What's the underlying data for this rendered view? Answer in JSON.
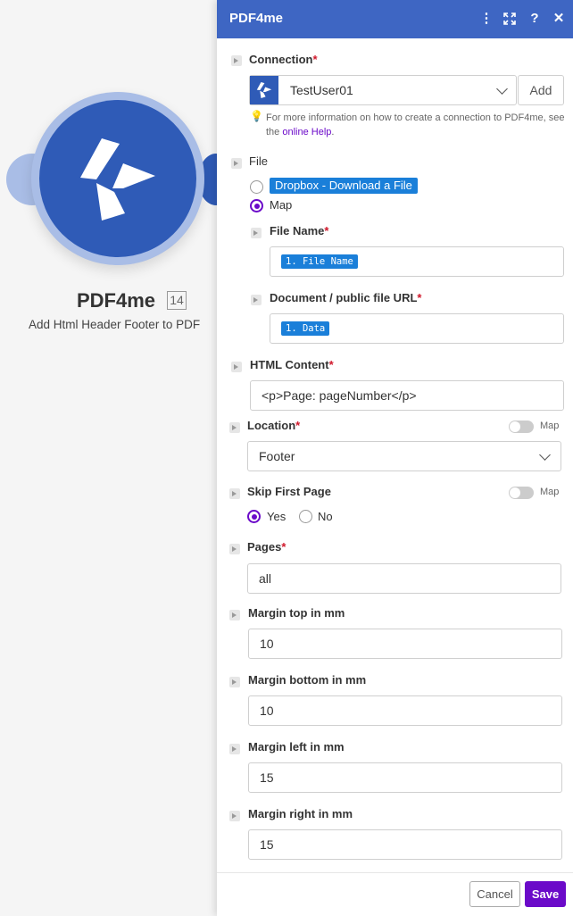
{
  "node": {
    "title": "PDF4me",
    "badge": "14",
    "subtitle": "Add Html Header Footer to PDF"
  },
  "panel": {
    "title": "PDF4me",
    "icons": [
      "more-vert-icon",
      "expand-icon",
      "help-icon",
      "close-icon"
    ]
  },
  "connection": {
    "label": "Connection",
    "value": "TestUser01",
    "add_label": "Add",
    "hint_prefix": "For more information on how to create a connection to PDF4me, see the ",
    "hint_link": "online Help",
    "hint_suffix": "."
  },
  "file": {
    "label": "File",
    "option1": "Dropbox - Download a File",
    "option2": "Map",
    "file_name_label": "File Name",
    "file_name_chip": "1. File Name",
    "url_label": "Document / public file URL",
    "url_chip": "1. Data"
  },
  "html_content": {
    "label": "HTML Content",
    "value": "<p>Page: pageNumber</p>"
  },
  "location": {
    "label": "Location",
    "map_label": "Map",
    "value": "Footer"
  },
  "skip_first_page": {
    "label": "Skip First Page",
    "map_label": "Map",
    "yes_label": "Yes",
    "no_label": "No",
    "selected": "Yes"
  },
  "pages": {
    "label": "Pages",
    "value": "all"
  },
  "margin_top": {
    "label": "Margin top in mm",
    "value": "10"
  },
  "margin_bottom": {
    "label": "Margin bottom in mm",
    "value": "10"
  },
  "margin_left": {
    "label": "Margin left in mm",
    "value": "15"
  },
  "margin_right": {
    "label": "Margin right in mm",
    "value": "15"
  },
  "footer": {
    "cancel_label": "Cancel",
    "save_label": "Save"
  },
  "colors": {
    "header": "#3e66c3",
    "accent": "#6b0ac9",
    "chip": "#1a7fd9",
    "node": "#2f5bb7"
  }
}
